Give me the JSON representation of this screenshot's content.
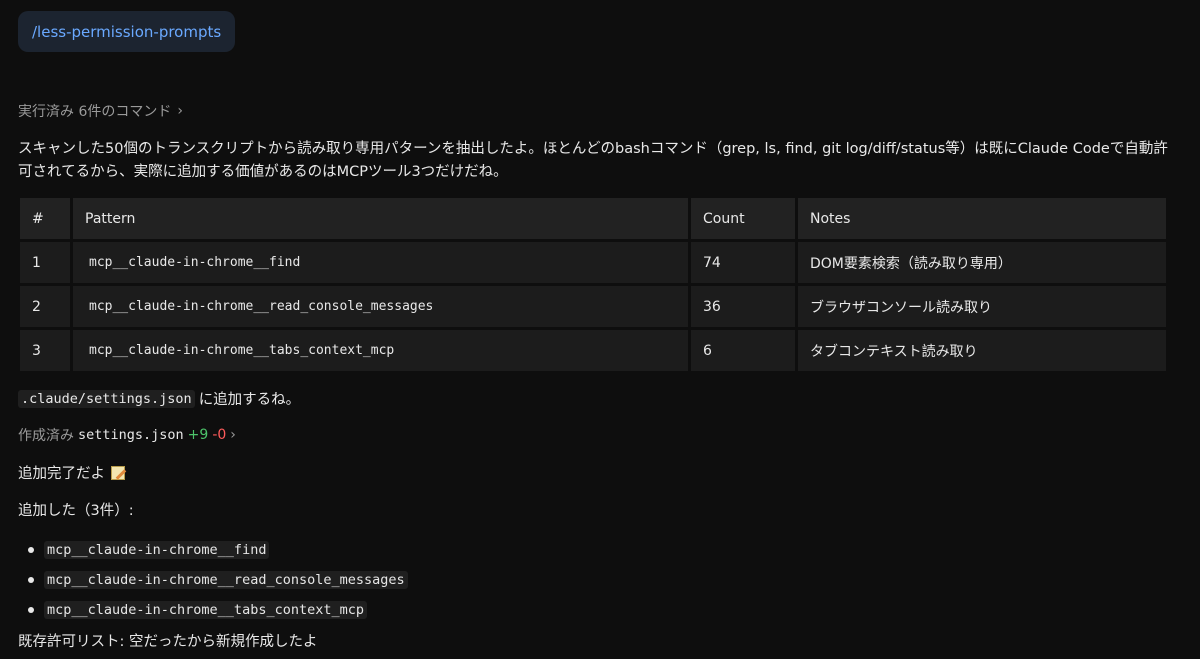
{
  "command_chip": "/less-permission-prompts",
  "executed": {
    "label": "実行済み 6件のコマンド",
    "chevron": "›"
  },
  "intro": "スキャンした50個のトランスクリプトから読み取り専用パターンを抽出したよ。ほとんどのbashコマンド（grep, ls, find, git log/diff/status等）は既にClaude Codeで自動許可されてるから、実際に追加する価値があるのはMCPツール3つだけだね。",
  "table": {
    "headers": [
      "#",
      "Pattern",
      "Count",
      "Notes"
    ],
    "rows": [
      {
        "num": "1",
        "pattern": "mcp__claude-in-chrome__find",
        "count": "74",
        "notes": "DOM要素検索（読み取り専用）"
      },
      {
        "num": "2",
        "pattern": "mcp__claude-in-chrome__read_console_messages",
        "count": "36",
        "notes": "ブラウザコンソール読み取り"
      },
      {
        "num": "3",
        "pattern": "mcp__claude-in-chrome__tabs_context_mcp",
        "count": "6",
        "notes": "タブコンテキスト読み取り"
      }
    ]
  },
  "settings_line": {
    "code": ".claude/settings.json",
    "text": "に追加するね。"
  },
  "created": {
    "label": "作成済み",
    "file": "settings.json",
    "added": "+9",
    "removed": "-0",
    "chevron": "›"
  },
  "done_text": "追加完了だよ",
  "added_heading": "追加した（3件）:",
  "added_items": [
    "mcp__claude-in-chrome__find",
    "mcp__claude-in-chrome__read_console_messages",
    "mcp__claude-in-chrome__tabs_context_mcp"
  ],
  "existing_text": "既存許可リスト: 空だったから新規作成したよ",
  "icons": {
    "memo": "memo-icon",
    "chevron": "chevron-right-icon"
  },
  "colors": {
    "link": "#6aa9ff",
    "added": "#4cc26a",
    "removed": "#ff5b5b"
  }
}
